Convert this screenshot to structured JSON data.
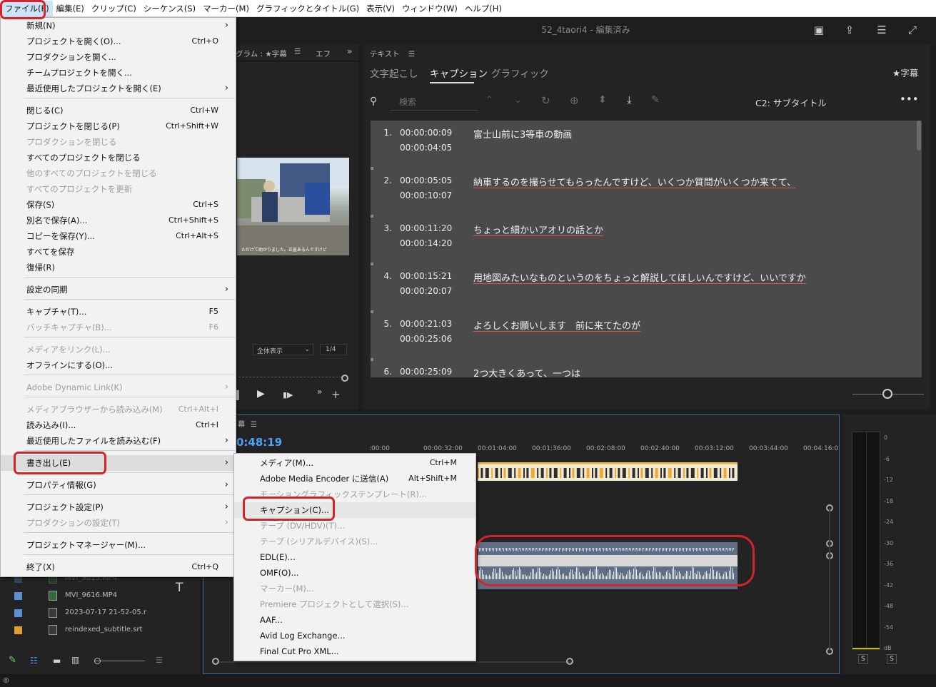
{
  "menubar": {
    "items": [
      "ファイル(F)",
      "編集(E)",
      "クリップ(C)",
      "シーケンス(S)",
      "マーカー(M)",
      "グラフィックとタイトル(G)",
      "表示(V)",
      "ウィンドウ(W)",
      "ヘルプ(H)"
    ]
  },
  "window": {
    "title": "52_4taori4 - 編集済み"
  },
  "program": {
    "tab_label": "グラム : ★字幕",
    "tab_fx": "エフ",
    "zoom": "全体表示",
    "fraction": "1/4",
    "subtitle_overlay": "ただけて助かりました。正直あるんですけど"
  },
  "text_panel": {
    "header": "テキスト",
    "tabs": [
      "文字起こし",
      "キャプション",
      "グラフィック"
    ],
    "active_tab": "キャプション",
    "right_label": "★字幕",
    "search_placeholder": "検索",
    "track_label": "C2: サブタイトル"
  },
  "captions": [
    {
      "n": "1.",
      "in": "00:00:00:09",
      "out": "00:00:04:05",
      "text": "富士山前に3等車の動画",
      "underline": false
    },
    {
      "n": "2.",
      "in": "00:00:05:05",
      "out": "00:00:10:07",
      "text": "納車するのを撮らせてもらったんですけど、いくつか質問がいくつか来てて、",
      "underline": true
    },
    {
      "n": "3.",
      "in": "00:00:11:20",
      "out": "00:00:14:20",
      "text": "ちょっと細かいアオリの話とか",
      "underline": true
    },
    {
      "n": "4.",
      "in": "00:00:15:21",
      "out": "00:00:20:07",
      "text": "用地図みたいなものというのをちょっと解説してほしいんですけど、いいですか",
      "underline": true
    },
    {
      "n": "5.",
      "in": "00:00:21:03",
      "out": "00:00:25:06",
      "text": "よろしくお願いします　前に来てたのが",
      "underline": true
    },
    {
      "n": "6.",
      "in": "00:00:25:09",
      "out": "",
      "text": "2つ大きくあって、一つは",
      "underline": false
    }
  ],
  "timeline": {
    "tab": "幕",
    "timecode": "0:48:19",
    "ruler": [
      ":00:00",
      "00:00:32:00",
      "00:01:04:00",
      "00:01:36:00",
      "00:02:08:00",
      "00:02:40:00",
      "00:03:12:00",
      "00:03:44:00",
      "00:04:16:0"
    ]
  },
  "meter": {
    "scale": [
      "0",
      "-6",
      "-12",
      "-18",
      "-24",
      "-30",
      "-36",
      "-42",
      "-48",
      "-54",
      "dB"
    ],
    "solo": [
      "S",
      "S"
    ]
  },
  "project": {
    "files": [
      {
        "name": "MVI_9615.MP4",
        "color": "#5b8fd0",
        "kind": "video"
      },
      {
        "name": "MVI_9616.MP4",
        "color": "#5b8fd0",
        "kind": "video"
      },
      {
        "name": "2023-07-17 21-52-05.r",
        "color": "#5b8fd0",
        "kind": "file"
      },
      {
        "name": "reindexed_subtitle.srt",
        "color": "#e0a030",
        "kind": "file"
      }
    ]
  },
  "file_menu": {
    "items": [
      {
        "label": "新規(N)",
        "sc": "",
        "arrow": true,
        "dis": false
      },
      {
        "label": "プロジェクトを開く(O)...",
        "sc": "Ctrl+O",
        "arrow": false,
        "dis": false
      },
      {
        "label": "プロダクションを開く...",
        "sc": "",
        "arrow": false,
        "dis": false
      },
      {
        "label": "チームプロジェクトを開く...",
        "sc": "",
        "arrow": false,
        "dis": false
      },
      {
        "label": "最近使用したプロジェクトを開く(E)",
        "sc": "",
        "arrow": true,
        "dis": false
      },
      {
        "label": "閉じる(C)",
        "sc": "Ctrl+W",
        "arrow": false,
        "dis": false
      },
      {
        "label": "プロジェクトを閉じる(P)",
        "sc": "Ctrl+Shift+W",
        "arrow": false,
        "dis": false
      },
      {
        "label": "プロダクションを閉じる",
        "sc": "",
        "arrow": false,
        "dis": true
      },
      {
        "label": "すべてのプロジェクトを閉じる",
        "sc": "",
        "arrow": false,
        "dis": false
      },
      {
        "label": "他のすべてのプロジェクトを閉じる",
        "sc": "",
        "arrow": false,
        "dis": true
      },
      {
        "label": "すべてのプロジェクトを更新",
        "sc": "",
        "arrow": false,
        "dis": true
      },
      {
        "label": "保存(S)",
        "sc": "Ctrl+S",
        "arrow": false,
        "dis": false
      },
      {
        "label": "別名で保存(A)...",
        "sc": "Ctrl+Shift+S",
        "arrow": false,
        "dis": false
      },
      {
        "label": "コピーを保存(Y)...",
        "sc": "Ctrl+Alt+S",
        "arrow": false,
        "dis": false
      },
      {
        "label": "すべてを保存",
        "sc": "",
        "arrow": false,
        "dis": false
      },
      {
        "label": "復帰(R)",
        "sc": "",
        "arrow": false,
        "dis": false
      },
      {
        "label": "設定の同期",
        "sc": "",
        "arrow": true,
        "dis": false
      },
      {
        "label": "キャプチャ(T)...",
        "sc": "F5",
        "arrow": false,
        "dis": false
      },
      {
        "label": "バッチキャプチャ(B)...",
        "sc": "F6",
        "arrow": false,
        "dis": true
      },
      {
        "label": "メディアをリンク(L)...",
        "sc": "",
        "arrow": false,
        "dis": true
      },
      {
        "label": "オフラインにする(O)...",
        "sc": "",
        "arrow": false,
        "dis": false
      },
      {
        "label": "Adobe Dynamic Link(K)",
        "sc": "",
        "arrow": true,
        "dis": true
      },
      {
        "label": "メディアブラウザーから読み込み(M)",
        "sc": "Ctrl+Alt+I",
        "arrow": false,
        "dis": true
      },
      {
        "label": "読み込み(I)...",
        "sc": "Ctrl+I",
        "arrow": false,
        "dis": false
      },
      {
        "label": "最近使用したファイルを読み込む(F)",
        "sc": "",
        "arrow": true,
        "dis": false
      },
      {
        "label": "書き出し(E)",
        "sc": "",
        "arrow": true,
        "dis": false
      },
      {
        "label": "プロパティ情報(G)",
        "sc": "",
        "arrow": true,
        "dis": false
      },
      {
        "label": "プロジェクト設定(P)",
        "sc": "",
        "arrow": true,
        "dis": false
      },
      {
        "label": "プロダクションの設定(T)",
        "sc": "",
        "arrow": true,
        "dis": true
      },
      {
        "label": "プロジェクトマネージャー(M)...",
        "sc": "",
        "arrow": false,
        "dis": false
      },
      {
        "label": "終了(X)",
        "sc": "Ctrl+Q",
        "arrow": false,
        "dis": false
      }
    ]
  },
  "export_menu": {
    "items": [
      {
        "label": "メディア(M)...",
        "sc": "Ctrl+M",
        "dis": false
      },
      {
        "label": "Adobe Media Encoder に送信(A)",
        "sc": "Alt+Shift+M",
        "dis": false
      },
      {
        "label": "モーショングラフィックステンプレート(R)...",
        "sc": "",
        "dis": true
      },
      {
        "label": "キャプション(C)...",
        "sc": "",
        "dis": false
      },
      {
        "label": "テープ (DV/HDV)(T)...",
        "sc": "",
        "dis": true
      },
      {
        "label": "テープ (シリアルデバイス)(S)...",
        "sc": "",
        "dis": true
      },
      {
        "label": "EDL(E)...",
        "sc": "",
        "dis": false
      },
      {
        "label": "OMF(O)...",
        "sc": "",
        "dis": false
      },
      {
        "label": "マーカー(M)...",
        "sc": "",
        "dis": true
      },
      {
        "label": "Premiere プロジェクトとして選択(S)...",
        "sc": "",
        "dis": true
      },
      {
        "label": "AAF...",
        "sc": "",
        "dis": false
      },
      {
        "label": "Avid Log Exchange...",
        "sc": "",
        "dis": false
      },
      {
        "label": "Final Cut Pro XML...",
        "sc": "",
        "dis": false
      }
    ]
  }
}
